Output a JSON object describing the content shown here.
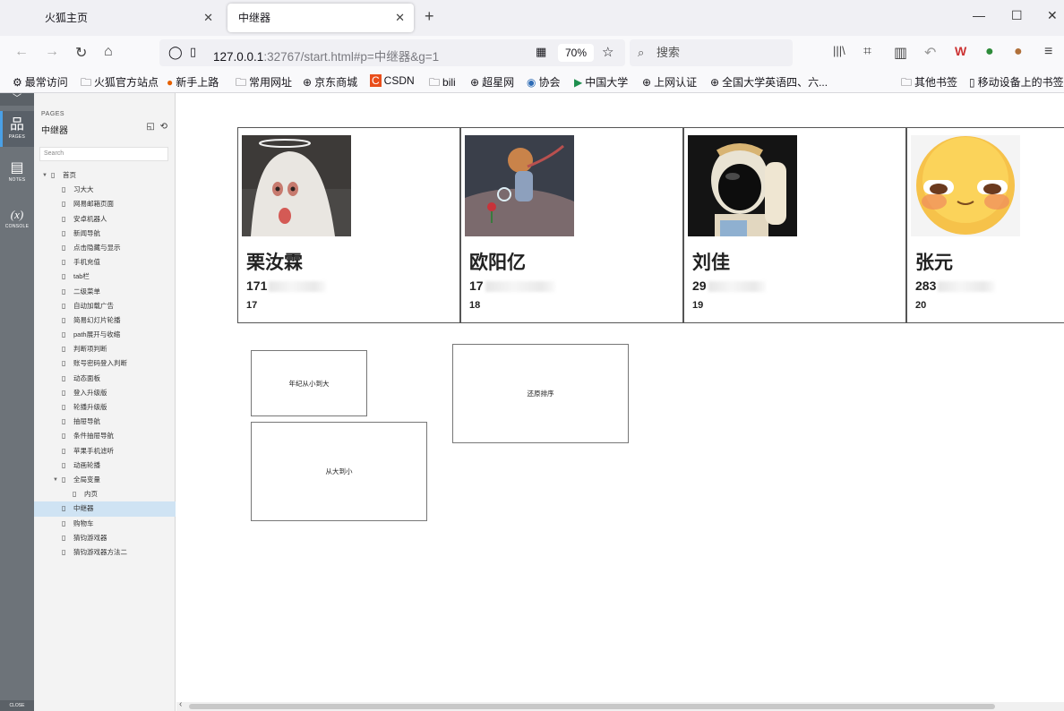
{
  "browser": {
    "tabs": [
      {
        "title": "火狐主页",
        "active": false
      },
      {
        "title": "中继器",
        "active": true
      }
    ],
    "url": {
      "host": "127.0.0.1",
      "rest": ":32767/start.html#p=中继器&g=1"
    },
    "zoom": "70%",
    "search_placeholder": "搜索",
    "bookmarks": [
      "最常访问",
      "火狐官方站点",
      "新手上路",
      "常用网址",
      "京东商城",
      "CSDN",
      "bili",
      "超星网",
      "协会",
      "中国大学",
      "上网认证",
      "全国大学英语四、六...",
      "其他书签",
      "移动设备上的书签"
    ]
  },
  "iconbar": {
    "items": [
      {
        "label": "PAGES",
        "icon": "sitemap-icon"
      },
      {
        "label": "NOTES",
        "icon": "notes-icon"
      },
      {
        "label": "CONSOLE",
        "icon": "variable-icon",
        "glyph": "(x)"
      }
    ],
    "close_label": "CLOSE"
  },
  "panel": {
    "header": "PAGES",
    "title": "中继器",
    "search_placeholder": "Search",
    "tree": [
      {
        "label": "首页",
        "depth": 0,
        "expanded": true
      },
      {
        "label": "习大大",
        "depth": 1
      },
      {
        "label": "网易邮箱页面",
        "depth": 1
      },
      {
        "label": "安卓机器人",
        "depth": 1
      },
      {
        "label": "新闻导航",
        "depth": 1
      },
      {
        "label": "点击隐藏与显示",
        "depth": 1
      },
      {
        "label": "手机充值",
        "depth": 1
      },
      {
        "label": "tab栏",
        "depth": 1
      },
      {
        "label": "二级菜单",
        "depth": 1
      },
      {
        "label": "自动加载广告",
        "depth": 1
      },
      {
        "label": "简易幻灯片轮播",
        "depth": 1
      },
      {
        "label": "path展开与收缩",
        "depth": 1
      },
      {
        "label": "判断项判断",
        "depth": 1
      },
      {
        "label": "账号密码登入判断",
        "depth": 1
      },
      {
        "label": "动态面板",
        "depth": 1
      },
      {
        "label": "登入升级版",
        "depth": 1
      },
      {
        "label": "轮播升级版",
        "depth": 1
      },
      {
        "label": "抽屉导航",
        "depth": 1
      },
      {
        "label": "条件抽屉导航",
        "depth": 1
      },
      {
        "label": "苹果手机滤听",
        "depth": 1
      },
      {
        "label": "动画轮播",
        "depth": 1
      },
      {
        "label": "全局变量",
        "depth": 1,
        "expanded": true
      },
      {
        "label": "内页",
        "depth": 2
      },
      {
        "label": "中继器",
        "depth": 1,
        "selected": true
      },
      {
        "label": "购物车",
        "depth": 1
      },
      {
        "label": "猜钧游戏器",
        "depth": 1
      },
      {
        "label": "猜钧游戏器方法二",
        "depth": 1
      }
    ]
  },
  "cards": [
    {
      "name": "栗汝霖",
      "phone_visible": "171",
      "age": "17",
      "photo": "ghost-photo"
    },
    {
      "name": "欧阳亿",
      "phone_visible": "17",
      "age": "18",
      "photo": "little-prince-photo"
    },
    {
      "name": "刘佳",
      "phone_visible": "29",
      "age": "19",
      "photo": "astronaut-photo"
    },
    {
      "name": "张元",
      "phone_visible": "283",
      "age": "20",
      "photo": "emoji-face-photo"
    }
  ],
  "buttons": {
    "age_asc": "年纪从小到大",
    "restore": "还原排序",
    "desc": "从大到小"
  },
  "colors": {
    "selected_row": "#cfe3f3",
    "iconbar": "#6d7379",
    "accent": "#4aa0e6"
  }
}
